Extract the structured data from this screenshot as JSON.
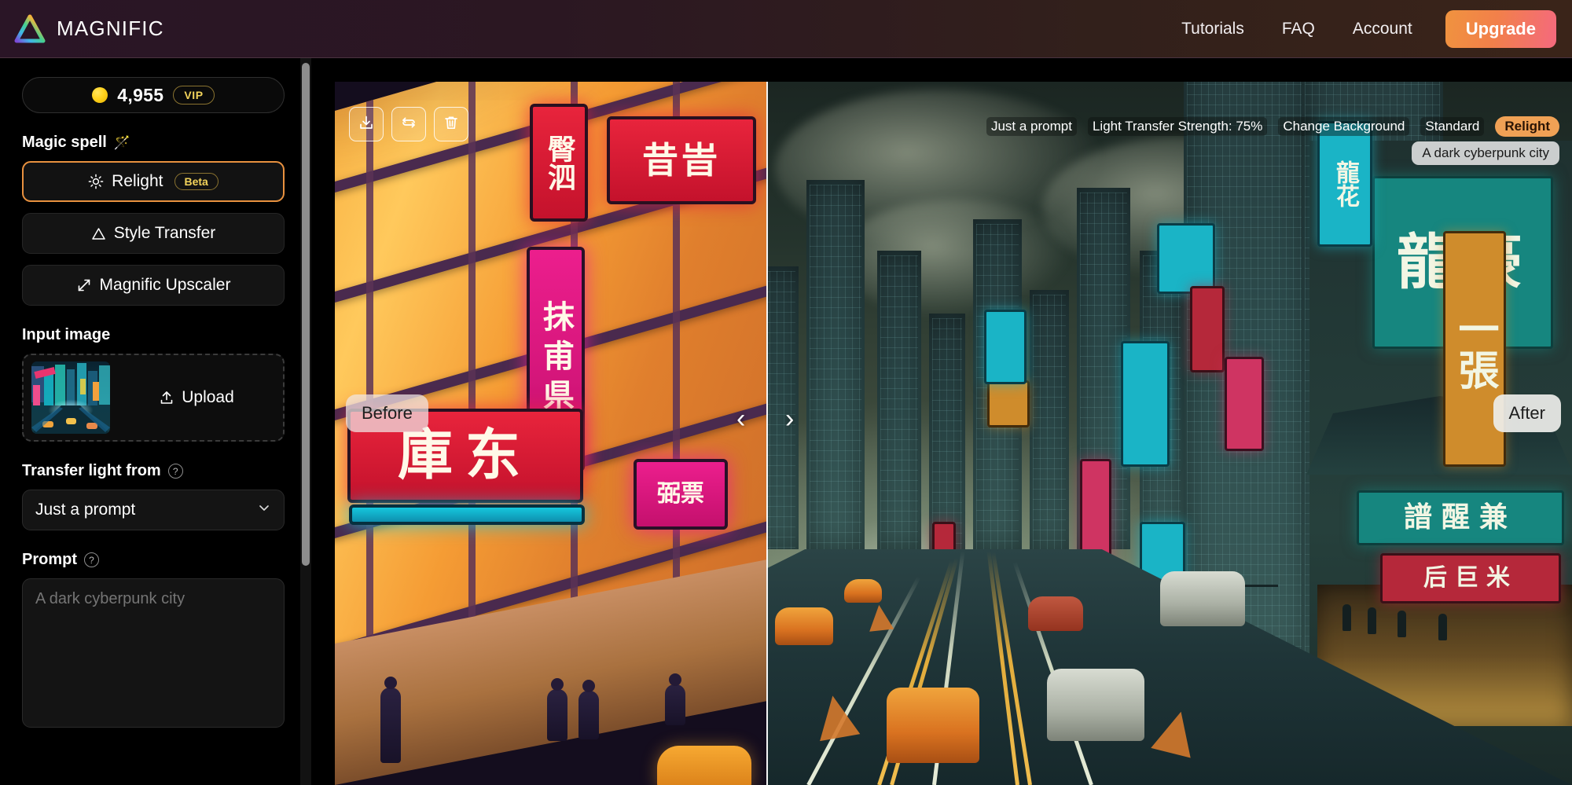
{
  "header": {
    "brand": "MAGNIFIC",
    "logo_icon": "magnific-triangle-logo",
    "nav": [
      {
        "label": "Tutorials"
      },
      {
        "label": "FAQ"
      },
      {
        "label": "Account"
      }
    ],
    "upgrade_label": "Upgrade",
    "colors": {
      "upgrade_gradient_from": "#f0933f",
      "upgrade_gradient_to": "#f4697e"
    }
  },
  "sidebar": {
    "credits": {
      "amount": "4,955",
      "badge": "VIP",
      "coin_icon": "coin-icon",
      "coin_color": "#ffd21e"
    },
    "magic_spell": {
      "label": "Magic spell",
      "wand_icon": "magic-wand-icon",
      "options": [
        {
          "label": "Relight",
          "badge": "Beta",
          "icon": "sun-icon",
          "selected": true
        },
        {
          "label": "Style Transfer",
          "badge": "",
          "icon": "triangle-icon",
          "selected": false
        },
        {
          "label": "Magnific Upscaler",
          "badge": "",
          "icon": "expand-arrows-icon",
          "selected": false
        }
      ],
      "accent_color": "#e8913f"
    },
    "input_image": {
      "label": "Input image",
      "upload_label": "Upload",
      "upload_icon": "upload-icon",
      "thumbnail_alt": "neon cyberpunk city street"
    },
    "transfer_light": {
      "label": "Transfer light from",
      "help_icon": "help-icon",
      "selected": "Just a prompt",
      "options": [
        "Just a prompt"
      ],
      "chevron_icon": "chevron-down-icon"
    },
    "prompt": {
      "label": "Prompt",
      "help_icon": "help-icon",
      "value": "A dark cyberpunk city",
      "placeholder": "A dark cyberpunk city"
    },
    "scrollbar": "vertical-scrollbar"
  },
  "canvas": {
    "tools": [
      {
        "name": "download-button",
        "icon": "download-icon"
      },
      {
        "name": "regenerate-button",
        "icon": "refresh-icon"
      },
      {
        "name": "delete-button",
        "icon": "trash-icon"
      }
    ],
    "labels": [
      {
        "text": "Just a prompt",
        "kind": "plain"
      },
      {
        "text": "Light Transfer Strength: 75%",
        "kind": "plain"
      },
      {
        "text": "Change Background",
        "kind": "plain"
      },
      {
        "text": "Standard",
        "kind": "plain"
      },
      {
        "text": "Relight",
        "kind": "badge",
        "color": "#f0a155"
      }
    ],
    "prompt_chip": "A dark cyberpunk city",
    "compare": {
      "before_label": "Before",
      "after_label": "After",
      "handle_left_icon": "chevron-left-icon",
      "handle_right_icon": "chevron-right-icon",
      "split_percent": 35
    },
    "before_image_alt": "Warm neon-lit city street with orange windows and red, pink and cyan signs",
    "after_image_alt": "Dark teal cyberpunk city avenue with skyscrapers, neon billboards and traffic"
  }
}
